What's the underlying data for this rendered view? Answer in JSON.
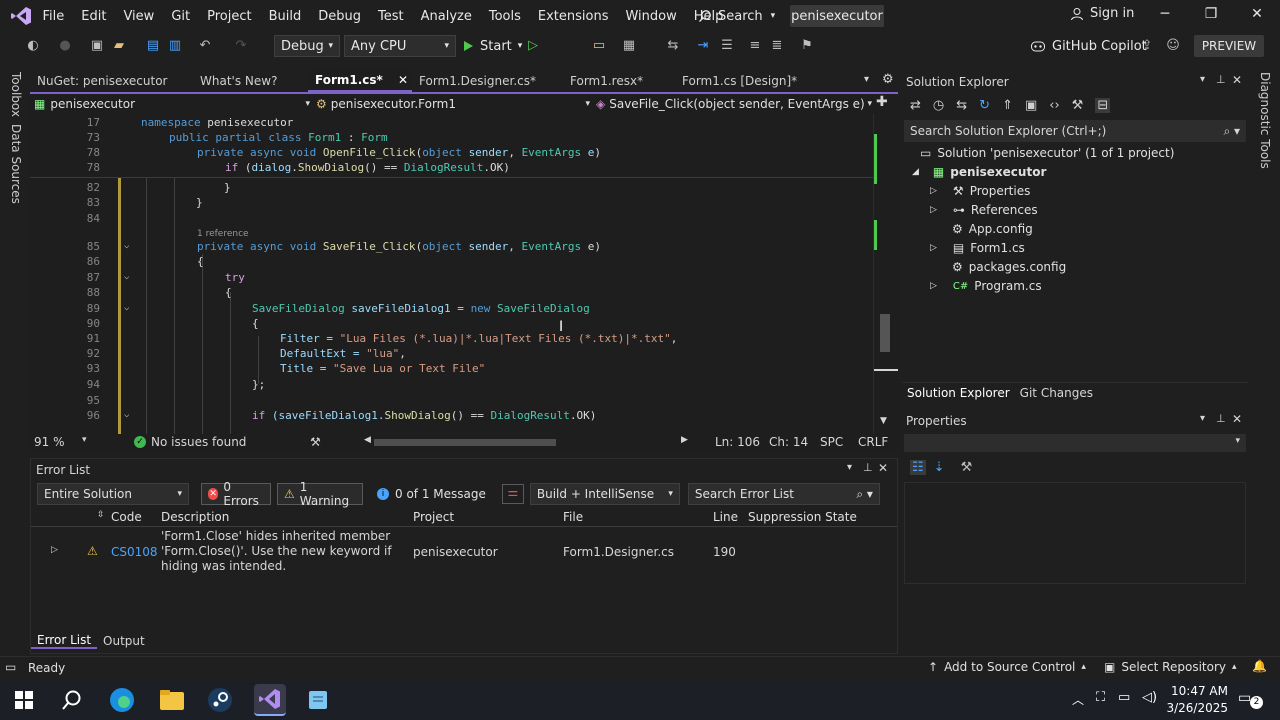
{
  "menu": [
    "File",
    "Edit",
    "View",
    "Git",
    "Project",
    "Build",
    "Debug",
    "Test",
    "Analyze",
    "Tools",
    "Extensions",
    "Window",
    "Help"
  ],
  "search_label": "Search",
  "project_badge": "penisexecutor",
  "signin": "Sign in",
  "toolbar": {
    "config": "Debug",
    "platform": "Any CPU",
    "start": "Start",
    "copilot": "GitHub Copilot",
    "preview": "PREVIEW"
  },
  "left_rail": [
    "Toolbox",
    "Data Sources"
  ],
  "right_rail": [
    "Diagnostic Tools"
  ],
  "tabs": [
    {
      "label": "NuGet: penisexecutor"
    },
    {
      "label": "What's New?"
    },
    {
      "label": "Form1.cs*"
    },
    {
      "label": "Form1.Designer.cs*"
    },
    {
      "label": "Form1.resx*"
    },
    {
      "label": "Form1.cs [Design]*"
    }
  ],
  "navbar": {
    "project": "penisexecutor",
    "class": "penisexecutor.Form1",
    "member": "SaveFile_Click(object sender, EventArgs e)"
  },
  "sticky": [
    {
      "ln": "17",
      "text": "namespace penisexecutor"
    },
    {
      "ln": "73",
      "text": "public partial class Form1 : Form"
    },
    {
      "ln": "78",
      "text": "private async void OpenFile_Click(object sender, EventArgs e)"
    },
    {
      "ln": "",
      "text": "if (dialog.ShowDialog() == DialogResult.OK)"
    }
  ],
  "code": {
    "l82": "82",
    "l83": "83",
    "l84": "84",
    "l85": "85",
    "l86": "86",
    "l87": "87",
    "l88": "88",
    "l89": "89",
    "l90": "90",
    "l91": "91",
    "l92": "92",
    "l93": "93",
    "l94": "94",
    "l95": "95",
    "l96": "96",
    "refs": "1 reference",
    "c82": "}",
    "c83": "}",
    "c85_a": "private async void ",
    "c85_b": "SaveFile_Click",
    "c85_c": "(",
    "c85_d": "object",
    "c85_e": " sender, ",
    "c85_f": "EventArgs",
    "c85_g": " e)",
    "c86": "{",
    "c87": "try",
    "c88": "{",
    "c89_a": "SaveFileDialog",
    "c89_b": " saveFileDialog1 = ",
    "c89_c": "new",
    "c89_d": " SaveFileDialog",
    "c90": "{",
    "c91_a": "Filter = ",
    "c91_b": "\"Lua Files (*.lua)|*.lua|Text Files (*.txt)|*.txt\"",
    "c91_c": ",",
    "c92_a": "DefaultExt = ",
    "c92_b": "\"lua\"",
    "c92_c": ",",
    "c93_a": "Title = ",
    "c93_b": "\"Save Lua or Text File\"",
    "c94": "};",
    "c96_a": "if",
    "c96_b": " (saveFileDialog1.",
    "c96_c": "ShowDialog",
    "c96_d": "() == ",
    "c96_e": "DialogResult",
    "c96_f": ".OK)"
  },
  "editor_status": {
    "zoom": "91 %",
    "issues": "No issues found",
    "ln": "Ln: 106",
    "ch": "Ch: 14",
    "spc": "SPC",
    "crlf": "CRLF"
  },
  "error_list": {
    "title": "Error List",
    "scope": "Entire Solution",
    "errors": "0 Errors",
    "warnings": "1 Warning",
    "messages": "0 of 1 Message",
    "build": "Build + IntelliSense",
    "search": "Search Error List",
    "columns": [
      "Code",
      "Description",
      "Project",
      "File",
      "Line",
      "Suppression State"
    ],
    "row": {
      "code": "CS0108",
      "description": "'Form1.Close' hides inherited member 'Form.Close()'. Use the new keyword if hiding was intended.",
      "project": "penisexecutor",
      "file": "Form1.Designer.cs",
      "line": "190"
    },
    "tabs": [
      "Error List",
      "Output"
    ]
  },
  "solution_explorer": {
    "title": "Solution Explorer",
    "search": "Search Solution Explorer (Ctrl+;)",
    "solution": "Solution 'penisexecutor' (1 of 1 project)",
    "project": "penisexecutor",
    "items": [
      "Properties",
      "References",
      "App.config",
      "Form1.cs",
      "packages.config",
      "Program.cs"
    ],
    "tabs": [
      "Solution Explorer",
      "Git Changes"
    ]
  },
  "properties": {
    "title": "Properties"
  },
  "statusbar": {
    "ready": "Ready",
    "source_control": "Add to Source Control",
    "repo": "Select Repository"
  },
  "taskbar": {
    "time": "10:47 AM",
    "date": "3/26/2025",
    "notifications": "2"
  },
  "colors": {
    "accent": "#7f62c9",
    "keyword": "#569cd6",
    "type": "#4ec9b0",
    "method": "#dcdcaa",
    "string": "#d69d85",
    "warning": "#f2c744",
    "error": "#f14c4c"
  }
}
